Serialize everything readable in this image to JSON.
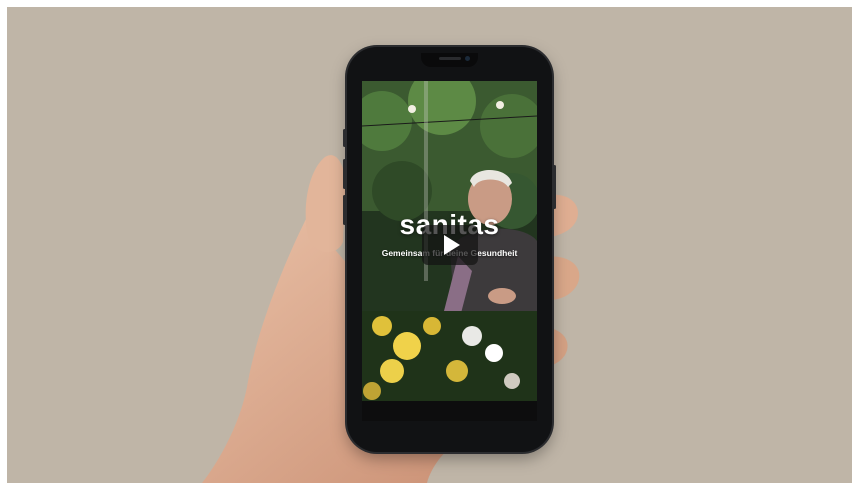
{
  "video": {
    "brand_title": "sanitas",
    "tagline": "Gemeinsam für deine Gesundheit",
    "play_button_icon": "play-icon"
  },
  "colors": {
    "background": "#bfb5a7",
    "phone_frame": "#111214",
    "overlay_text": "#ffffff"
  }
}
